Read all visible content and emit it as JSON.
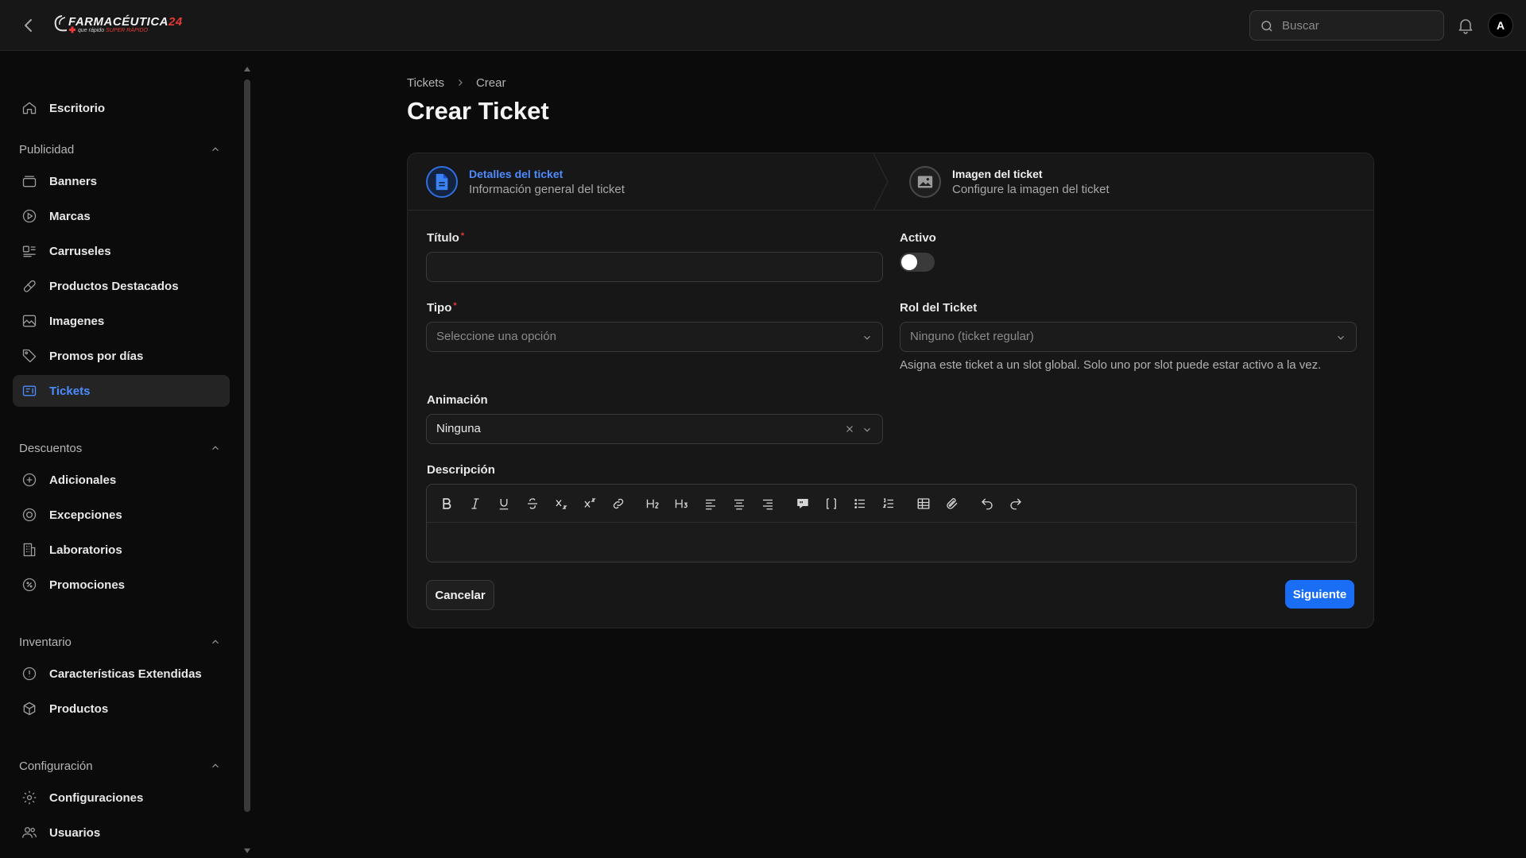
{
  "header": {
    "logo_main": "FARMACÉUTICA",
    "logo_num": "24",
    "logo_sub_1": "que rápido",
    "logo_sub_2": "SUPER RÁPIDO",
    "search_placeholder": "Buscar",
    "avatar_initial": "A"
  },
  "sidebar": {
    "top_item": "Escritorio",
    "groups": [
      {
        "label": "Publicidad",
        "items": [
          "Banners",
          "Marcas",
          "Carruseles",
          "Productos Destacados",
          "Imagenes",
          "Promos por días",
          "Tickets"
        ]
      },
      {
        "label": "Descuentos",
        "items": [
          "Adicionales",
          "Excepciones",
          "Laboratorios",
          "Promociones"
        ]
      },
      {
        "label": "Inventario",
        "items": [
          "Características Extendidas",
          "Productos"
        ]
      },
      {
        "label": "Configuración",
        "items": [
          "Configuraciones",
          "Usuarios"
        ]
      }
    ],
    "active_item": "Tickets"
  },
  "breadcrumb": {
    "parent": "Tickets",
    "current": "Crear"
  },
  "page": {
    "title": "Crear Ticket"
  },
  "steps": [
    {
      "title": "Detalles del ticket",
      "subtitle": "Información general del ticket",
      "active": true
    },
    {
      "title": "Imagen del ticket",
      "subtitle": "Configure la imagen del ticket",
      "active": false
    }
  ],
  "form": {
    "titulo": {
      "label": "Título",
      "value": ""
    },
    "activo": {
      "label": "Activo",
      "value": false
    },
    "tipo": {
      "label": "Tipo",
      "placeholder": "Seleccione una opción"
    },
    "rol": {
      "label": "Rol del Ticket",
      "value": "Ninguno (ticket regular)",
      "help": "Asigna este ticket a un slot global. Solo uno por slot puede estar activo a la vez."
    },
    "animacion": {
      "label": "Animación",
      "value": "Ninguna"
    },
    "descripcion": {
      "label": "Descripción",
      "value": ""
    },
    "cancel_label": "Cancelar",
    "next_label": "Siguiente"
  },
  "colors": {
    "accent": "#1a6ef5",
    "active_nav": "#4d8cff",
    "required": "#e53935"
  }
}
